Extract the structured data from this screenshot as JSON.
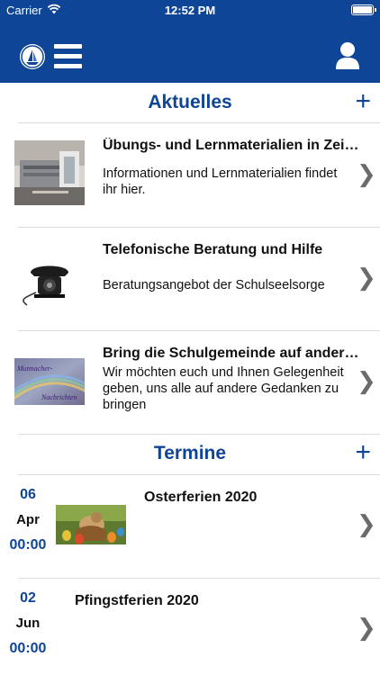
{
  "status_bar": {
    "carrier": "Carrier",
    "time": "12:52 PM"
  },
  "navbar": {
    "logo_icon": "ship-logo-icon",
    "menu_icon": "hamburger-menu-icon",
    "user_icon": "user-profile-icon",
    "color": "#0e4597"
  },
  "news_section": {
    "title": "Aktuelles",
    "add_label": "+",
    "items": [
      {
        "title": "Übungs- und Lernmaterialien in Zei…",
        "desc": "Informationen und Lernmaterialien findet ihr hier.",
        "thumb": "school-building-image"
      },
      {
        "title": "Telefonische Beratung und Hilfe",
        "desc": "Beratungsangebot der Schulseelsorge",
        "thumb": "telephone-image"
      },
      {
        "title": "Bring die Schulgemeinde auf ander…",
        "desc": "Wir möchten euch und Ihnen Gelegenheit geben, uns alle auf andere Gedanken zu bringen",
        "thumb": "rainbow-image",
        "thumb_text_1": "Mutmacher-",
        "thumb_text_2": "Nachrichten"
      }
    ]
  },
  "events_section": {
    "title": "Termine",
    "add_label": "+",
    "items": [
      {
        "day": "06",
        "month": "Apr",
        "time": "00:00",
        "title": "Osterferien 2020",
        "thumb": "easter-eggs-image"
      },
      {
        "day": "02",
        "month": "Jun",
        "time": "00:00",
        "title": "Pfingstferien 2020"
      }
    ]
  },
  "chevron": "❯"
}
